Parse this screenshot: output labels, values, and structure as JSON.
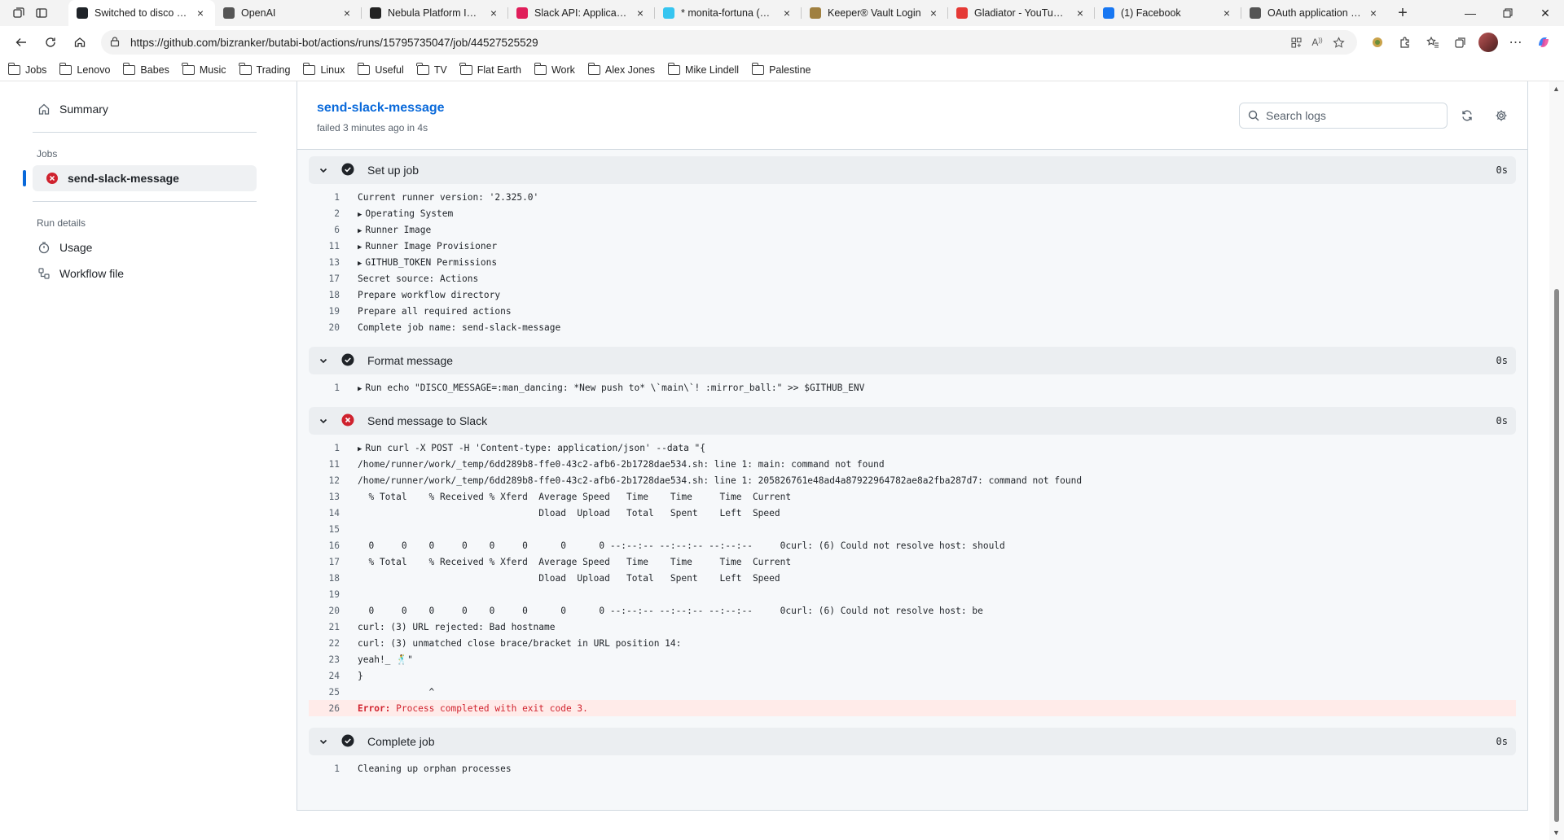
{
  "browser": {
    "tabs": [
      {
        "title": "Switched to disco Slack",
        "icon": "github-icon",
        "fav_color": "#1f2328",
        "active": true
      },
      {
        "title": "OpenAI",
        "icon": "openai-icon",
        "fav_color": "#555555"
      },
      {
        "title": "Nebula Platform Interview",
        "icon": "nebula-icon",
        "fav_color": "#222222"
      },
      {
        "title": "Slack API: Applications",
        "icon": "slack-icon",
        "fav_color": "#e01e5a"
      },
      {
        "title": "* monita-fortuna (Channel)",
        "icon": "slack-icon",
        "fav_color": "#36c5f0"
      },
      {
        "title": "Keeper® Vault Login",
        "icon": "keeper-icon",
        "fav_color": "#a08040"
      },
      {
        "title": "Gladiator - YouTube TV",
        "icon": "youtube-icon",
        "fav_color": "#e53935"
      },
      {
        "title": "(1) Facebook",
        "icon": "facebook-icon",
        "fav_color": "#1877f2"
      },
      {
        "title": "OAuth application auth",
        "icon": "github-icon",
        "fav_color": "#555555"
      }
    ],
    "url": "https://github.com/bizranker/butabi-bot/actions/runs/15795735047/job/44527525529",
    "bookmarks": [
      "Jobs",
      "Lenovo",
      "Babes",
      "Music",
      "Trading",
      "Linux",
      "Useful",
      "TV",
      "Flat Earth",
      "Work",
      "Alex Jones",
      "Mike Lindell",
      "Palestine"
    ]
  },
  "sidebar": {
    "summary": "Summary",
    "jobs_heading": "Jobs",
    "job": "send-slack-message",
    "run_details_heading": "Run details",
    "usage": "Usage",
    "workflow_file": "Workflow file"
  },
  "job": {
    "title": "send-slack-message",
    "status": "failed 3 minutes ago in 4s",
    "search_placeholder": "Search logs"
  },
  "steps": [
    {
      "name": "Set up job",
      "status": "success",
      "duration": "0s",
      "lines": [
        {
          "n": "1",
          "text": "Current runner version: '2.325.0'"
        },
        {
          "n": "2",
          "text": "Operating System",
          "group": true
        },
        {
          "n": "6",
          "text": "Runner Image",
          "group": true
        },
        {
          "n": "11",
          "text": "Runner Image Provisioner",
          "group": true
        },
        {
          "n": "13",
          "text": "GITHUB_TOKEN Permissions",
          "group": true
        },
        {
          "n": "17",
          "text": "Secret source: Actions"
        },
        {
          "n": "18",
          "text": "Prepare workflow directory"
        },
        {
          "n": "19",
          "text": "Prepare all required actions"
        },
        {
          "n": "20",
          "text": "Complete job name: send-slack-message"
        }
      ]
    },
    {
      "name": "Format message",
      "status": "success",
      "duration": "0s",
      "lines": [
        {
          "n": "1",
          "text": "Run echo \"DISCO_MESSAGE=:man_dancing: *New push to* \\`main\\`! :mirror_ball:\" >> $GITHUB_ENV",
          "group": true
        }
      ]
    },
    {
      "name": "Send message to Slack",
      "status": "failure",
      "duration": "0s",
      "lines": [
        {
          "n": "1",
          "text": "Run curl -X POST -H 'Content-type: application/json' --data \"{",
          "group": true
        },
        {
          "n": "11",
          "text": "/home/runner/work/_temp/6dd289b8-ffe0-43c2-afb6-2b1728dae534.sh: line 1: main: command not found"
        },
        {
          "n": "12",
          "text": "/home/runner/work/_temp/6dd289b8-ffe0-43c2-afb6-2b1728dae534.sh: line 1: 205826761e48ad4a87922964782ae8a2fba287d7: command not found"
        },
        {
          "n": "13",
          "text": "  % Total    % Received % Xferd  Average Speed   Time    Time     Time  Current"
        },
        {
          "n": "14",
          "text": "                                 Dload  Upload   Total   Spent    Left  Speed"
        },
        {
          "n": "15",
          "text": ""
        },
        {
          "n": "16",
          "text": "  0     0    0     0    0     0      0      0 --:--:-- --:--:-- --:--:--     0curl: (6) Could not resolve host: should"
        },
        {
          "n": "17",
          "text": "  % Total    % Received % Xferd  Average Speed   Time    Time     Time  Current"
        },
        {
          "n": "18",
          "text": "                                 Dload  Upload   Total   Spent    Left  Speed"
        },
        {
          "n": "19",
          "text": ""
        },
        {
          "n": "20",
          "text": "  0     0    0     0    0     0      0      0 --:--:-- --:--:-- --:--:--     0curl: (6) Could not resolve host: be"
        },
        {
          "n": "21",
          "text": "curl: (3) URL rejected: Bad hostname"
        },
        {
          "n": "22",
          "text": "curl: (3) unmatched close brace/bracket in URL position 14:"
        },
        {
          "n": "23",
          "text": "yeah!_ 🕺\""
        },
        {
          "n": "24",
          "text": "}"
        },
        {
          "n": "25",
          "text": "             ^"
        },
        {
          "n": "26",
          "text": " Process completed with exit code 3.",
          "error": true,
          "error_label": "Error:"
        }
      ]
    },
    {
      "name": "Complete job",
      "status": "success",
      "duration": "0s",
      "lines": [
        {
          "n": "1",
          "text": "Cleaning up orphan processes"
        }
      ]
    }
  ],
  "colors": {
    "accent": "#0969da",
    "success": "#1f2328",
    "failure": "#cf222e"
  }
}
